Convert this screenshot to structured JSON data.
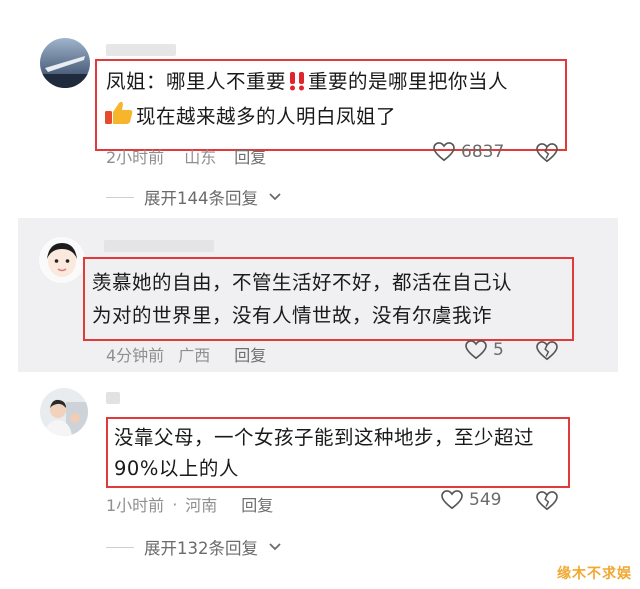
{
  "comments": [
    {
      "line1_a": "凤姐：哪里人不重要",
      "line1_b": "重要的是哪里把你当人",
      "line2": "现在越来越多的人明白凤姐了",
      "time": "2小时前",
      "location": "山东",
      "reply_label": "回复",
      "likes": "6837",
      "expand_label": "展开144条回复"
    },
    {
      "line1": "羡慕她的自由，不管生活好不好，都活在自己认",
      "line2": "为对的世界里，没有人情世故，没有尔虞我诈",
      "time": "4分钟前",
      "location": "广西",
      "reply_label": "回复",
      "likes": "5"
    },
    {
      "line1": "没靠父母，一个女孩子能到这种地步，至少超过",
      "line2": "90%以上的人",
      "time": "1小时前",
      "separator": "·",
      "location": "河南",
      "reply_label": "回复",
      "likes": "549",
      "expand_label": "展开132条回复"
    }
  ],
  "icons": {
    "double_exclamation": "double-exclamation-icon",
    "thumbs_up": "thumbs-up-icon",
    "heart": "heart-icon",
    "broken_heart": "broken-heart-icon",
    "chevron": "chevron-down-icon"
  },
  "colors": {
    "highlight_border": "#e23a3a",
    "watermark": "#f0a830"
  },
  "watermark": "缘木不求娱"
}
